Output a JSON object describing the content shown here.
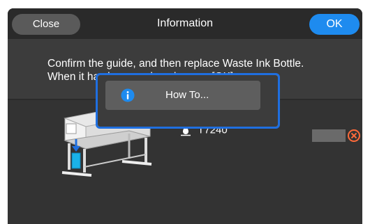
{
  "header": {
    "close_label": "Close",
    "title": "Information",
    "ok_label": "OK"
  },
  "message": {
    "line1": "Confirm the guide, and then replace Waste Ink Bottle.",
    "line2": "When it has been replaced, press [OK]."
  },
  "ink": {
    "icon": "ink-drop-icon",
    "label": "T7240",
    "status_icon": "error-x-icon"
  },
  "howto": {
    "icon": "info-icon",
    "label": "How To..."
  },
  "colors": {
    "accent": "#1e8bef",
    "focus": "#1f6fe0",
    "error": "#ff6a3a",
    "background": "#3c3c3c"
  }
}
